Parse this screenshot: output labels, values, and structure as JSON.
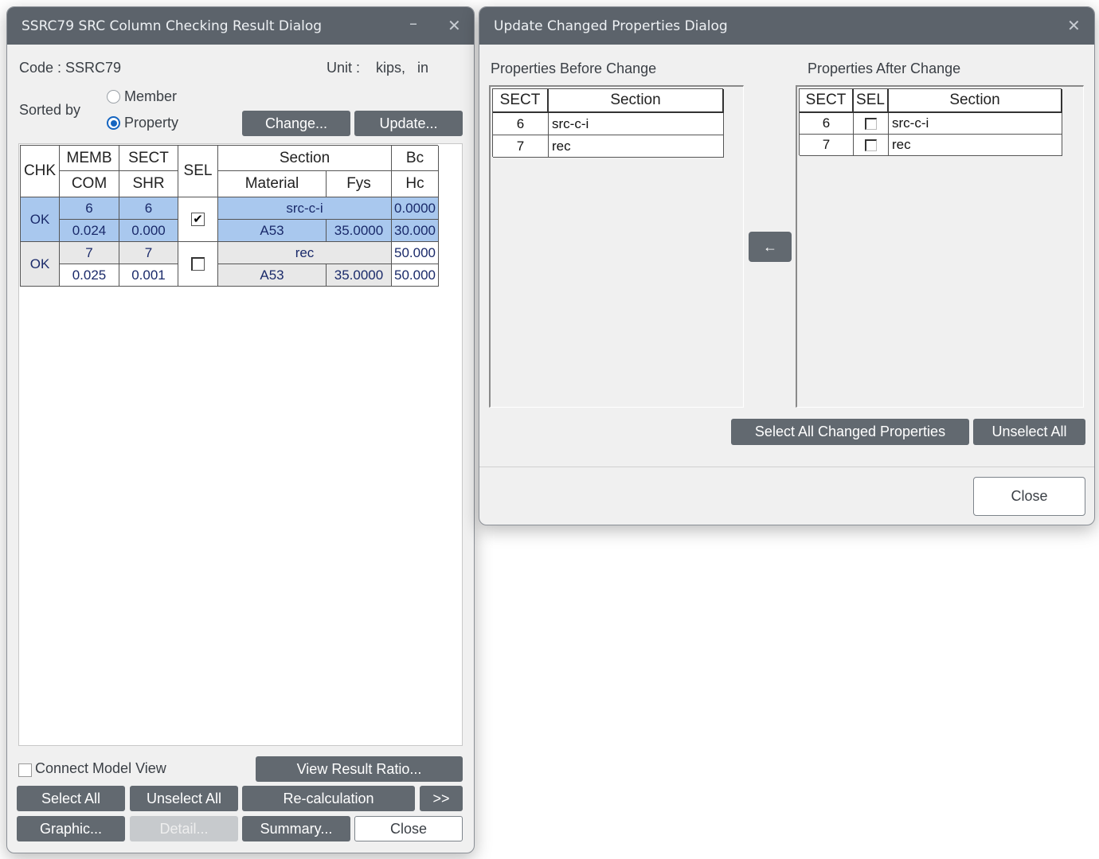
{
  "left_dialog": {
    "title": "SSRC79 SRC Column Checking Result Dialog",
    "code_label": "Code : SSRC79",
    "unit_label": "Unit :",
    "unit_value": "kips,   in",
    "sorted_by_label": "Sorted by",
    "radio_member": "Member",
    "radio_property": "Property",
    "change_button": "Change...",
    "update_button": "Update...",
    "table": {
      "headers": {
        "chk": "CHK",
        "memb": "MEMB",
        "sect": "SECT",
        "sel": "SEL",
        "section": "Section",
        "bc": "Bc",
        "com": "COM",
        "shr": "SHR",
        "material": "Material",
        "fys": "Fys",
        "hc": "Hc"
      },
      "rows": [
        {
          "chk": "OK",
          "memb": "6",
          "sect": "6",
          "section": "src-c-i",
          "bc": "0.0000",
          "com": "0.024",
          "shr": "0.000",
          "material": "A53",
          "fys": "35.0000",
          "hc": "30.000",
          "selected": true
        },
        {
          "chk": "OK",
          "memb": "7",
          "sect": "7",
          "section": "rec",
          "bc": "50.000",
          "com": "0.025",
          "shr": "0.001",
          "material": "A53",
          "fys": "35.0000",
          "hc": "50.000",
          "selected": false
        }
      ]
    },
    "connect_model_view": "Connect Model View",
    "view_result_ratio": "View Result Ratio...",
    "select_all": "Select All",
    "unselect_all": "Unselect All",
    "recalculation": "Re-calculation",
    "more": ">>",
    "graphic": "Graphic...",
    "detail": "Detail...",
    "summary": "Summary...",
    "close": "Close"
  },
  "right_dialog": {
    "title": "Update Changed Properties Dialog",
    "before_label": "Properties Before Change",
    "after_label": "Properties After Change",
    "before_table": {
      "headers": {
        "sect": "SECT",
        "section": "Section"
      },
      "rows": [
        {
          "sect": "6",
          "section": "src-c-i"
        },
        {
          "sect": "7",
          "section": "rec"
        }
      ]
    },
    "after_table": {
      "headers": {
        "sect": "SECT",
        "sel": "SEL",
        "section": "Section"
      },
      "rows": [
        {
          "sect": "6",
          "section": "src-c-i"
        },
        {
          "sect": "7",
          "section": "rec"
        }
      ]
    },
    "arrow_icon": "←",
    "select_all_changed": "Select All Changed Properties",
    "unselect_all": "Unselect All",
    "close": "Close"
  },
  "colors": {
    "titlebar": "#5c636b",
    "button": "#626970",
    "selected_row": "#a9c8ee",
    "radio_accent": "#1565c0"
  }
}
